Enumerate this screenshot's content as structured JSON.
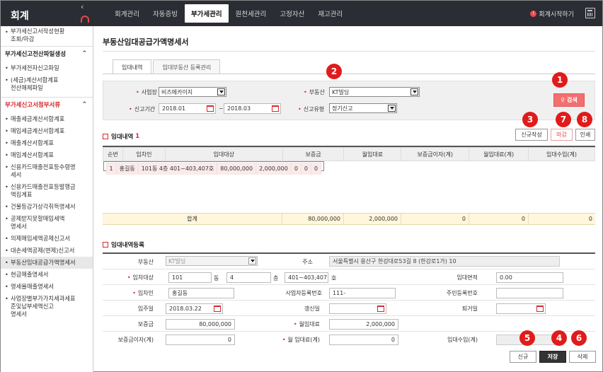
{
  "app": {
    "title": "회계",
    "nav_tabs": [
      {
        "label": "회계관리",
        "active": false
      },
      {
        "label": "자동증빙",
        "active": false
      },
      {
        "label": "부가세관리",
        "active": true
      },
      {
        "label": "원천세관리",
        "active": false
      },
      {
        "label": "고정자산",
        "active": false
      },
      {
        "label": "재고관리",
        "active": false
      }
    ],
    "start_accounting": "회계시작하기",
    "accent_color": "#d8272b"
  },
  "sidebar": {
    "top_item": "부가세신고서작성현황\n조회/마감",
    "groups": [
      {
        "title": "부가세신고전산파일생성",
        "items": [
          "부가세전자신고파일",
          "(세금)계산서합계표\n전산매체파일"
        ]
      },
      {
        "title": "부가세신고서첨부서류",
        "items": [
          "매출세금계산서합계표",
          "매입세금계산서합계표",
          "매출계산서합계표",
          "매입계산서합계표",
          "신용카드매출전표등수령명\n세서",
          "신용카드매출전표등발행금\n액집계표",
          "건물등감가상각취득명세서",
          "공제받지못할매입세액\n명세서",
          "의제매입세액공제신고서",
          "대손세액공제(변제)신고서",
          "부동산임대공급가액명세서",
          "현금매출명세서",
          "영세율매출명세서",
          "사업장별부가가치세과세표\n준및납부세액신고\n명세서"
        ]
      }
    ],
    "active_item": "부동산임대공급가액명세서"
  },
  "page": {
    "title": "부동산임대공급가액명세서",
    "tabs": [
      "임대내역",
      "임대부동산 등록관리"
    ],
    "filter": {
      "business_label": "사업장",
      "business_value": "비즈메카이지",
      "property_label": "부동산",
      "property_value": "KT빌딩",
      "period_label": "신고기간",
      "period_from": "2018.01",
      "period_sep": "~",
      "period_to": "2018.03",
      "report_type_label": "신고유형",
      "report_type_value": "정기신고",
      "search_button": "검색"
    },
    "list_section": {
      "title": "임대내역",
      "count": "1"
    },
    "buttons": {
      "new_writer": "신규작성",
      "close": "마감",
      "print": "인쇄",
      "new": "신규",
      "save": "저장",
      "delete": "삭제"
    },
    "badges": [
      "1",
      "2",
      "3",
      "4",
      "5",
      "6",
      "7",
      "8"
    ],
    "table": {
      "headers": [
        "순번",
        "임차인",
        "임대대상",
        "보증금",
        "월임대료",
        "보증금이자(계)",
        "월임대료(계)",
        "임대수입(계)"
      ],
      "rows": [
        [
          "1",
          "홍길동",
          "101동 4층 401~403,407호",
          "80,000,000",
          "2,000,000",
          "0",
          "0",
          "0"
        ]
      ],
      "sum": [
        "합계",
        "80,000,000",
        "2,000,000",
        "0",
        "0",
        "0"
      ]
    },
    "form_section": {
      "title": "임대내역등록"
    },
    "form": {
      "property_label": "부동산",
      "property_value": "KT빌딩",
      "address_label": "주소",
      "address_value": "서울특별시 용산구 한강대로53길 8 (한강로1가) 10",
      "target_label": "임차대상",
      "dong_value": "101",
      "dong_unit": "동",
      "floor_value": "4",
      "floor_unit": "층",
      "ho_value": "401~403,407",
      "ho_unit": "호",
      "area_label": "임대면적",
      "area_value": "0.00",
      "tenant_label": "임차인",
      "tenant_value": "홍길동",
      "bizno_label": "사업자등록번호",
      "bizno_value": "111-",
      "resno_label": "주민등록번호",
      "resno_value": "",
      "movein_label": "입주일",
      "movein_value": "2018.03.22",
      "renew_label": "갱신일",
      "renew_value": "",
      "moveout_label": "퇴거일",
      "moveout_value": "",
      "deposit_label": "보증금",
      "deposit_value": "80,000,000",
      "rent_label": "월임대료",
      "rent_value": "2,000,000",
      "interest_label": "보증금이자(계)",
      "interest_value": "0",
      "rent_total_label": "월 임대료(계)",
      "rent_total_value": "0",
      "income_label": "임대수입(계)",
      "income_value": ""
    }
  }
}
